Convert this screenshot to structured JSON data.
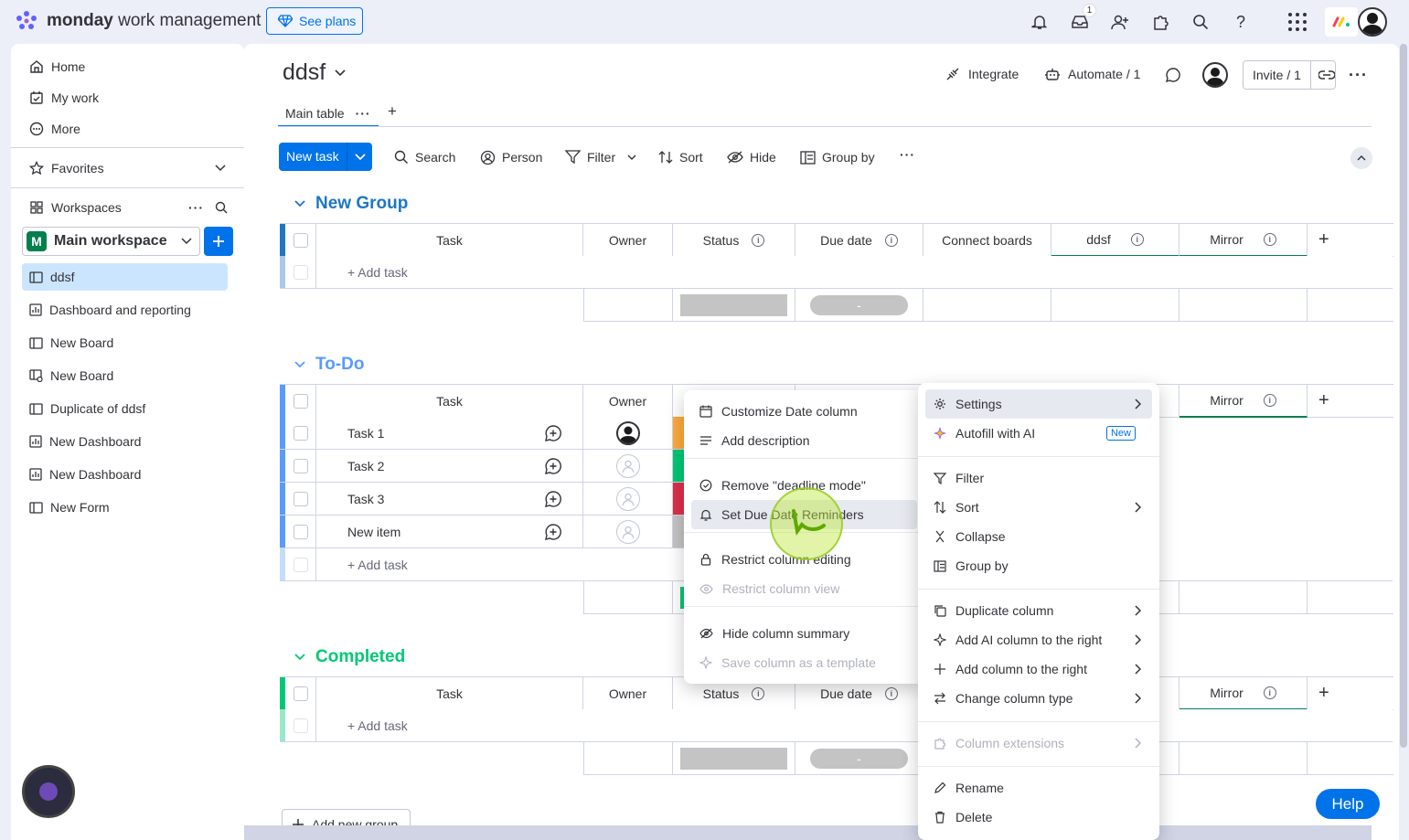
{
  "topbar": {
    "brand_bold": "monday",
    "brand_rest": " work management",
    "see_plans": "See plans",
    "inbox_badge": "1"
  },
  "sidebar": {
    "home": "Home",
    "my_work": "My work",
    "more": "More",
    "favorites": "Favorites",
    "workspaces": "Workspaces",
    "workspace_name": "Main workspace",
    "workspace_initial": "M",
    "items": [
      {
        "label": "ddsf",
        "icon": "board-icon",
        "active": true
      },
      {
        "label": "Dashboard and reporting",
        "icon": "dashboard-icon"
      },
      {
        "label": "New Board",
        "icon": "board-icon"
      },
      {
        "label": "New Board",
        "icon": "board-shared-icon"
      },
      {
        "label": "Duplicate of ddsf",
        "icon": "board-icon"
      },
      {
        "label": "New Dashboard",
        "icon": "dashboard-icon"
      },
      {
        "label": "New Dashboard",
        "icon": "dashboard-icon"
      },
      {
        "label": "New Form",
        "icon": "form-icon"
      }
    ]
  },
  "board": {
    "title": "ddsf",
    "integrate": "Integrate",
    "automate": "Automate / 1",
    "invite": "Invite / 1",
    "tab_main": "Main table",
    "add_tab": "+"
  },
  "toolbar": {
    "new_task": "New task",
    "search": "Search",
    "person": "Person",
    "filter": "Filter",
    "sort": "Sort",
    "hide": "Hide",
    "group_by": "Group by"
  },
  "columns": {
    "task": "Task",
    "owner": "Owner",
    "status": "Status",
    "due_date": "Due date",
    "connect": "Connect boards",
    "ddsf": "ddsf",
    "mirror": "Mirror",
    "add_task": "+ Add task",
    "summary_date": "-"
  },
  "groups": [
    {
      "name": "New Group",
      "color": "#037f4c"
    },
    {
      "name": "To-Do",
      "color": "#579bfc"
    },
    {
      "name": "Completed",
      "color": "#00c875"
    }
  ],
  "group_colors": {
    "new_group": "#1f76c2",
    "todo": "#579bfc",
    "completed": "#00c875"
  },
  "todo_rows": [
    {
      "task": "Task 1",
      "status_color": "#fdab3d",
      "owner": "filled"
    },
    {
      "task": "Task 2",
      "status_color": "#00c875",
      "owner": "empty"
    },
    {
      "task": "Task 3",
      "status_color": "#df2f4a",
      "owner": "empty"
    },
    {
      "task": "New item",
      "status_color": "#c4c4c4",
      "owner": "empty"
    }
  ],
  "add_group": "Add new group",
  "left_menu": {
    "items": [
      {
        "label": "Customize Date column",
        "icon": "calendar-icon"
      },
      {
        "label": "Add description",
        "icon": "description-icon"
      },
      {
        "label": "Remove \"deadline mode\"",
        "icon": "check-circle-icon"
      },
      {
        "label": "Set Due Date Reminders",
        "icon": "bell-icon"
      },
      {
        "label": "Restrict column editing",
        "icon": "lock-icon"
      },
      {
        "label": "Restrict column view",
        "icon": "eye-icon"
      },
      {
        "label": "Hide column summary",
        "icon": "eye-off-icon"
      },
      {
        "label": "Save column as a template",
        "icon": "template-icon"
      }
    ]
  },
  "right_menu": {
    "settings": "Settings",
    "autofill": "Autofill with AI",
    "new_tag": "New",
    "filter": "Filter",
    "sort": "Sort",
    "collapse": "Collapse",
    "group_by": "Group by",
    "duplicate": "Duplicate column",
    "add_ai": "Add AI column to the right",
    "add_col": "Add column to the right",
    "change_type": "Change column type",
    "extensions": "Column extensions",
    "rename": "Rename",
    "delete": "Delete"
  },
  "help": "Help",
  "colors": {
    "accent": "#0073ea"
  }
}
